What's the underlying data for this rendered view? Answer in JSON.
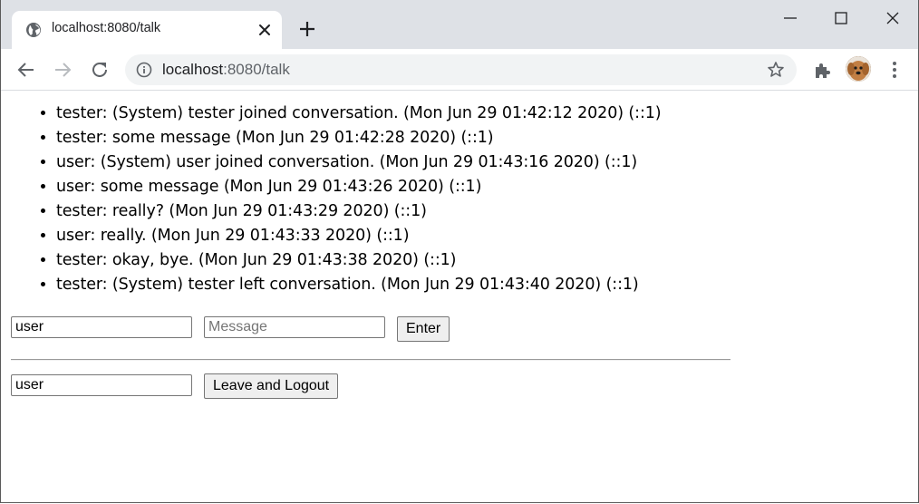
{
  "browser": {
    "tab_title": "localhost:8080/talk",
    "url_host": "localhost",
    "url_rest": ":8080/talk"
  },
  "icons": [
    "globe-icon",
    "close-icon",
    "plus-icon",
    "minimize-icon",
    "maximize-icon",
    "window-close-icon",
    "back-icon",
    "forward-icon",
    "reload-icon",
    "info-icon",
    "star-icon",
    "extensions-icon",
    "avatar",
    "menu-icon"
  ],
  "messages": [
    "tester: (System) tester joined conversation. (Mon Jun 29 01:42:12 2020) (::1)",
    "tester: some message (Mon Jun 29 01:42:28 2020) (::1)",
    "user: (System) user joined conversation. (Mon Jun 29 01:43:16 2020) (::1)",
    "user: some message (Mon Jun 29 01:43:26 2020) (::1)",
    "tester: really? (Mon Jun 29 01:43:29 2020) (::1)",
    "user: really. (Mon Jun 29 01:43:33 2020) (::1)",
    "tester: okay, bye. (Mon Jun 29 01:43:38 2020) (::1)",
    "tester: (System) tester left conversation. (Mon Jun 29 01:43:40 2020) (::1)"
  ],
  "form": {
    "name_value": "user",
    "message_value": "",
    "message_placeholder": "Message",
    "enter_label": "Enter"
  },
  "logout": {
    "name_value": "user",
    "button_label": "Leave and Logout"
  }
}
